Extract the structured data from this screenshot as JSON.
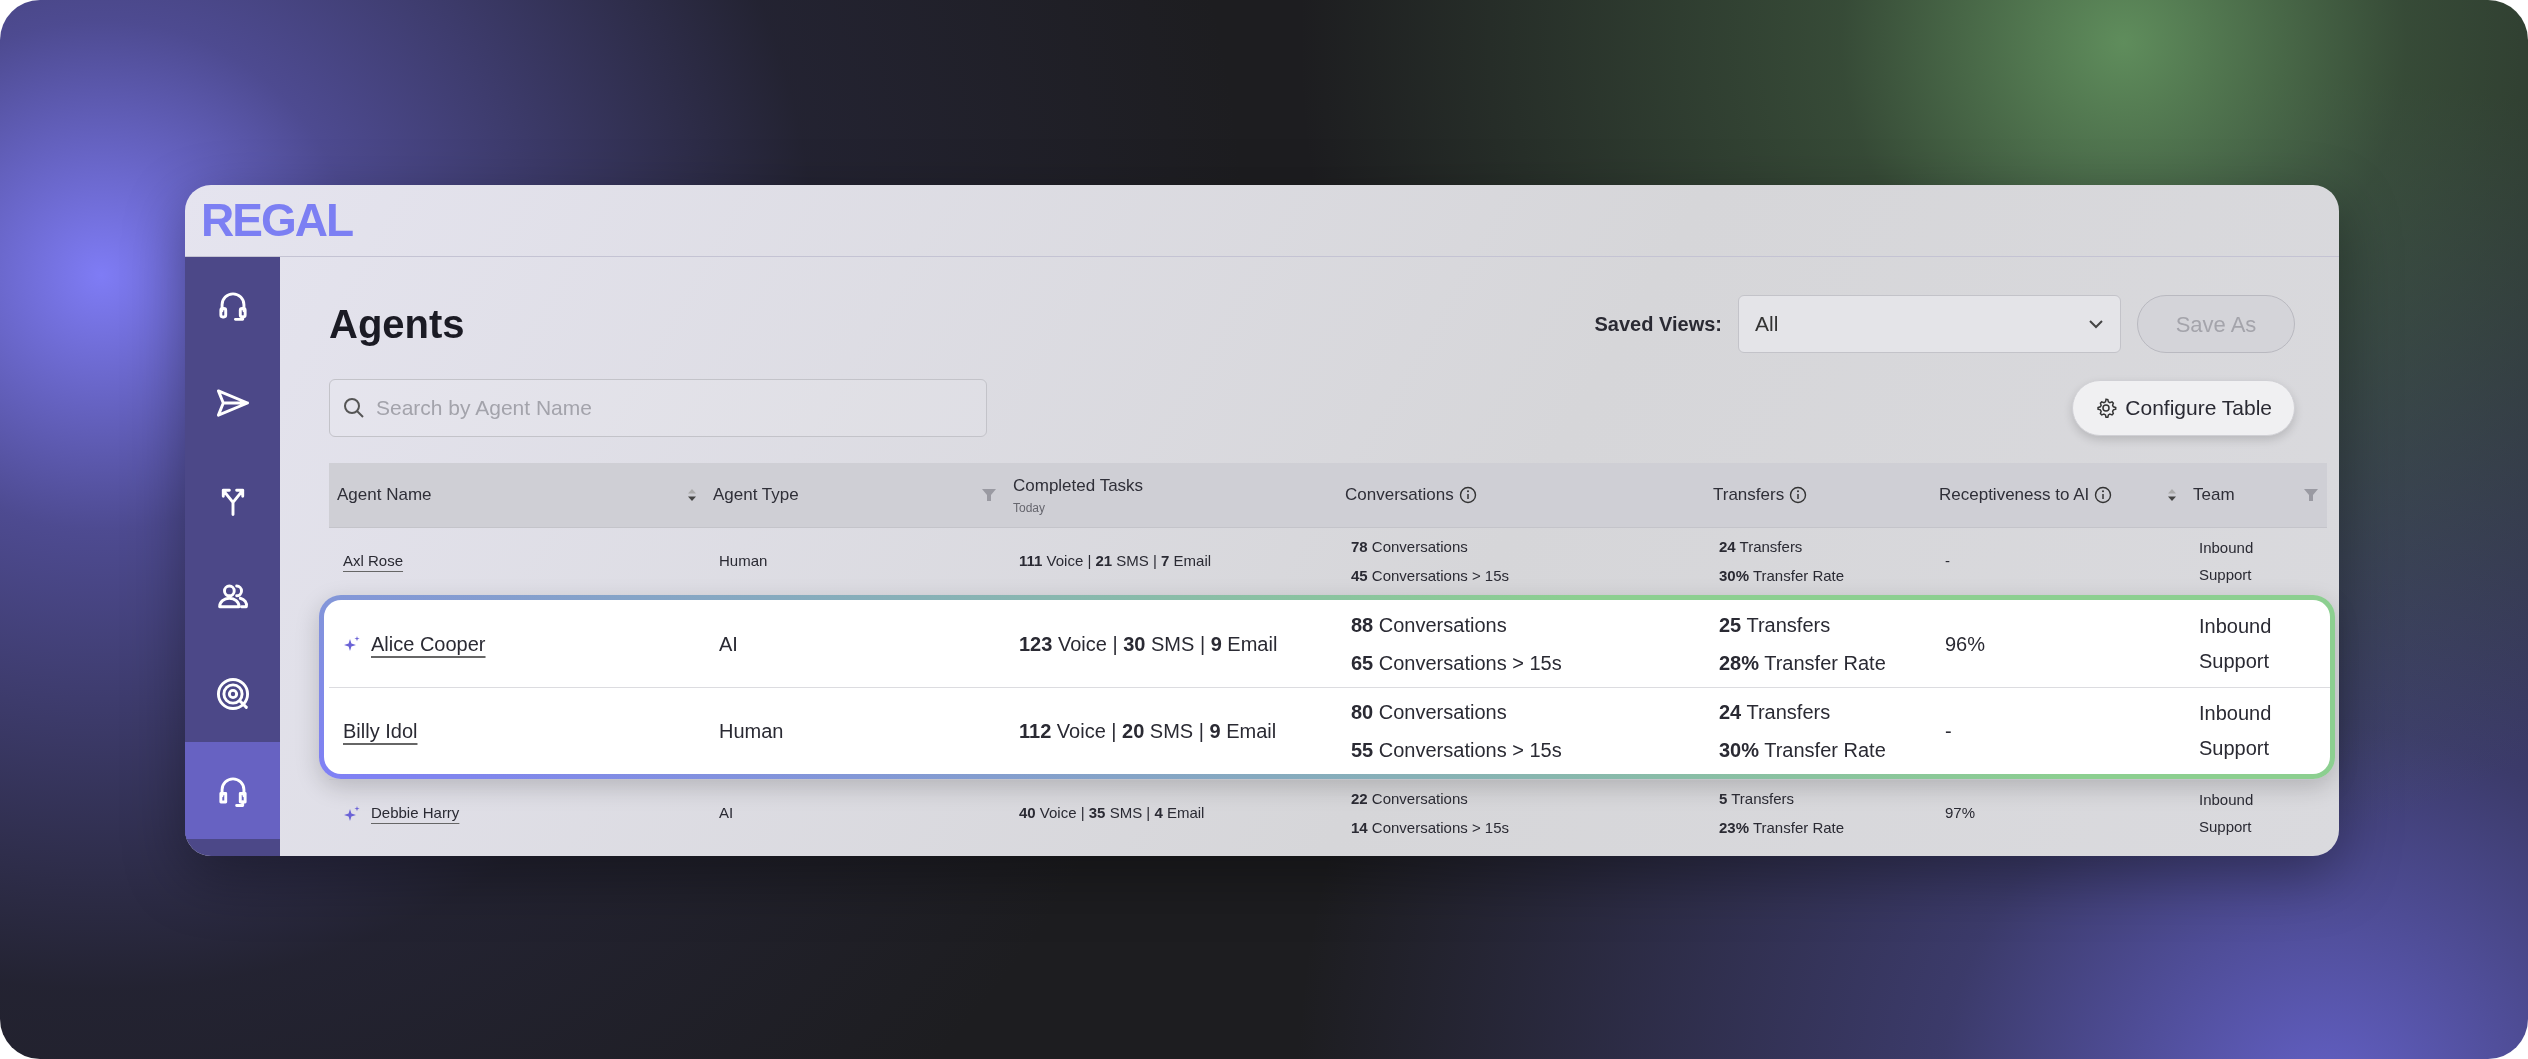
{
  "logo": "REGAL",
  "sidebar": {
    "items": [
      {
        "kind": "headset",
        "selected": false
      },
      {
        "kind": "send",
        "selected": false
      },
      {
        "kind": "split",
        "selected": false
      },
      {
        "kind": "people",
        "selected": false
      },
      {
        "kind": "target",
        "selected": false
      },
      {
        "kind": "headset-outline",
        "selected": true
      }
    ]
  },
  "page": {
    "title": "Agents",
    "saved_views": {
      "label": "Saved Views:",
      "value": "All"
    },
    "save_as": {
      "label": "Save As",
      "disabled": true
    },
    "configure_button": "Configure Table",
    "search": {
      "placeholder": "Search by Agent Name"
    }
  },
  "table": {
    "columns": [
      {
        "label": "Agent Name",
        "sortable": true
      },
      {
        "label": "Agent Type",
        "filterable": true
      },
      {
        "label": "Completed Tasks",
        "sub": "Today"
      },
      {
        "label": "Conversations",
        "info": true
      },
      {
        "label": "Transfers",
        "info": true
      },
      {
        "label": "Receptiveness to AI",
        "info": true,
        "sortable": true
      },
      {
        "label": "Team",
        "filterable": true
      }
    ],
    "rows": [
      {
        "name": "Axl Rose",
        "ai": false,
        "highlighted": false,
        "type": "Human",
        "tasks": "**111** Voice | **21** SMS | **7** Email",
        "conversations": "**78** Conversations",
        "conversations_long": "**45** Conversations > 15s",
        "transfers": "**24** Transfers",
        "transfer_rate": "**30%** Transfer Rate",
        "receptiveness": "-",
        "team": "Inbound Support"
      },
      {
        "name": "Alice Cooper",
        "ai": true,
        "highlighted": true,
        "type": "AI",
        "tasks": "**123** Voice | **30** SMS | **9** Email",
        "conversations": "**88** Conversations",
        "conversations_long": "**65** Conversations > 15s",
        "transfers": "**25** Transfers",
        "transfer_rate": "**28%** Transfer Rate",
        "receptiveness": "96%",
        "team": "Inbound Support"
      },
      {
        "name": "Billy Idol",
        "ai": false,
        "highlighted": true,
        "type": "Human",
        "tasks": "**112** Voice | **20** SMS | **9** Email",
        "conversations": "**80** Conversations",
        "conversations_long": "**55** Conversations > 15s",
        "transfers": "**24** Transfers",
        "transfer_rate": "**30%** Transfer Rate",
        "receptiveness": "-",
        "team": "Inbound Support"
      },
      {
        "name": "Debbie Harry",
        "ai": true,
        "highlighted": false,
        "type": "AI",
        "tasks": "**40** Voice | **35** SMS | **4** Email",
        "conversations": "**22** Conversations",
        "conversations_long": "**14** Conversations > 15s",
        "transfers": "**5** Transfers",
        "transfer_rate": "**23%** Transfer Rate",
        "receptiveness": "97%",
        "team": "Inbound Support"
      }
    ]
  }
}
